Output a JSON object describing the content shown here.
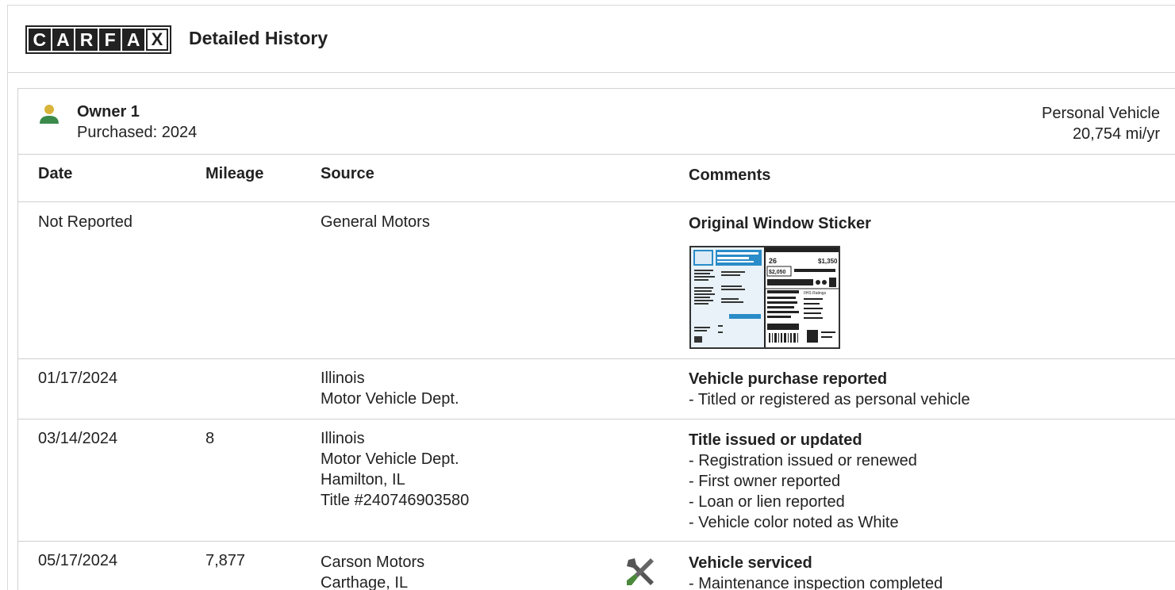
{
  "header": {
    "logo_letters": [
      "C",
      "A",
      "R",
      "F",
      "A",
      "X"
    ],
    "title": "Detailed History"
  },
  "owner": {
    "name": "Owner 1",
    "purchased": "Purchased: 2024",
    "type": "Personal Vehicle",
    "miles_per_year": "20,754 mi/yr",
    "icon": "person-icon"
  },
  "table": {
    "headers": {
      "date": "Date",
      "mileage": "Mileage",
      "source": "Source",
      "comments": "Comments"
    },
    "rows": [
      {
        "date": "Not Reported",
        "mileage": "",
        "source": [
          "General Motors"
        ],
        "comment_title": "Original Window Sticker",
        "comment_lines": [],
        "has_sticker": true
      },
      {
        "date": "01/17/2024",
        "mileage": "",
        "source": [
          "Illinois",
          "Motor Vehicle Dept."
        ],
        "comment_title": "Vehicle purchase reported",
        "comment_lines": [
          "- Titled or registered as personal vehicle"
        ]
      },
      {
        "date": "03/14/2024",
        "mileage": "8",
        "source": [
          "Illinois",
          "Motor Vehicle Dept.",
          "Hamilton, IL",
          "Title #240746903580"
        ],
        "comment_title": "Title issued or updated",
        "comment_lines": [
          "- Registration issued or renewed",
          "- First owner reported",
          "- Loan or lien reported",
          "- Vehicle color noted as White"
        ]
      },
      {
        "date": "05/17/2024",
        "mileage": "7,877",
        "source": [
          "Carson Motors",
          "Carthage, IL"
        ],
        "comment_title": "Vehicle serviced",
        "comment_lines": [
          "- Maintenance inspection completed"
        ],
        "icon": "wrench-screwdriver-icon"
      }
    ]
  },
  "sticker": {
    "mpg": "26",
    "save": "$1,350",
    "spend": "$2,050",
    "ratings_label": "IIHS Ratings"
  },
  "colors": {
    "owner_head": "#d9b43a",
    "owner_body": "#3a8a4a",
    "wrench": "#4a8a3a",
    "sticker_blue": "#2a8cc8"
  }
}
